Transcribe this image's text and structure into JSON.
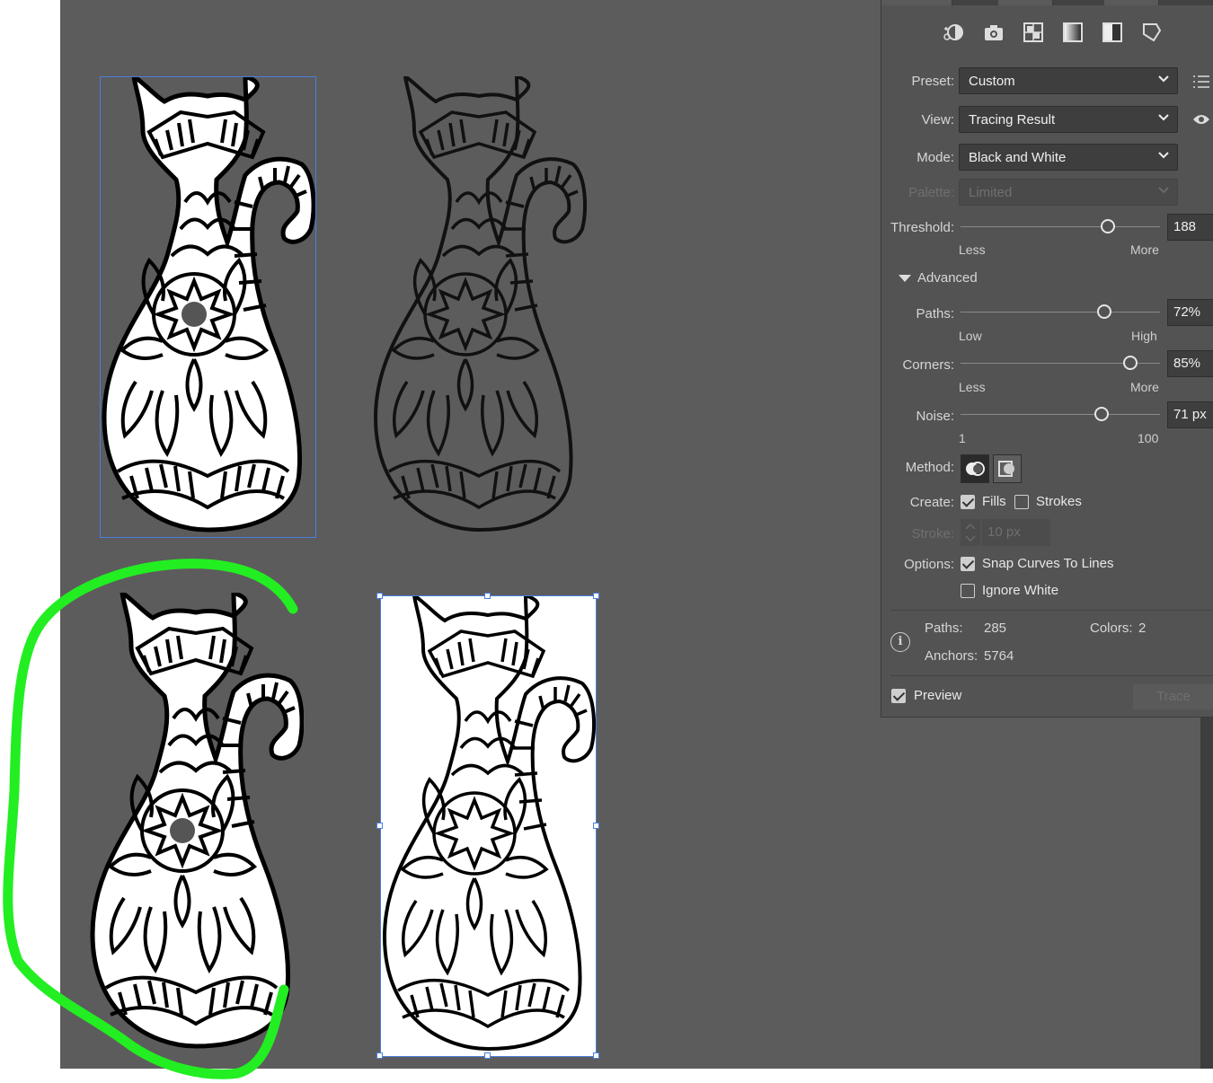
{
  "panel": {
    "preset": {
      "label": "Preset:",
      "value": "Custom"
    },
    "view": {
      "label": "View:",
      "value": "Tracing Result"
    },
    "mode": {
      "label": "Mode:",
      "value": "Black and White"
    },
    "palette": {
      "label": "Palette:",
      "value": "Limited"
    },
    "threshold": {
      "label": "Threshold:",
      "value": "188",
      "level": 188,
      "max": 255,
      "low": "Less",
      "high": "More"
    },
    "advanced": {
      "label": "Advanced"
    },
    "paths": {
      "label": "Paths:",
      "value": "72%",
      "level": 0.72,
      "low": "Low",
      "high": "High"
    },
    "corners": {
      "label": "Corners:",
      "value": "85%",
      "level": 0.85,
      "low": "Less",
      "high": "More"
    },
    "noise": {
      "label": "Noise:",
      "value": "71 px",
      "level": 71,
      "min": 1,
      "max": 100,
      "low": "1",
      "high": "100"
    },
    "method": {
      "label": "Method:"
    },
    "create": {
      "label": "Create:",
      "fills": "Fills",
      "strokes": "Strokes",
      "fills_checked": true,
      "strokes_checked": false
    },
    "stroke": {
      "label": "Stroke:",
      "value": "10 px"
    },
    "options": {
      "label": "Options:",
      "snap": "Snap Curves To Lines",
      "ignore_white": "Ignore White",
      "snap_checked": true,
      "ignore_white_checked": false
    },
    "stats": {
      "paths_label": "Paths:",
      "paths": "285",
      "colors_label": "Colors:",
      "colors": "2",
      "anchors_label": "Anchors:",
      "anchors": "5764"
    },
    "preview": {
      "label": "Preview",
      "checked": true
    },
    "trace_button": "Trace"
  },
  "icons": [
    "auto-color-icon",
    "high-color-icon",
    "low-color-icon",
    "grayscale-icon",
    "black-white-icon",
    "outline-icon"
  ],
  "colors": {
    "annotation": "#22ee22",
    "canvas": "#5c5c5c",
    "panel": "#535353",
    "selection": "#4a7fdc"
  }
}
